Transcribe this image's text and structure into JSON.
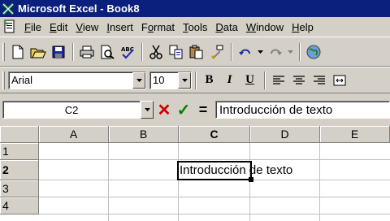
{
  "window": {
    "title": "Microsoft Excel - Book8"
  },
  "menu": {
    "items": [
      {
        "accel": "F",
        "rest": "ile"
      },
      {
        "accel": "E",
        "rest": "dit"
      },
      {
        "accel": "V",
        "rest": "iew"
      },
      {
        "accel": "I",
        "rest": "nsert"
      },
      {
        "pre": "F",
        "accel": "o",
        "rest": "rmat"
      },
      {
        "accel": "T",
        "rest": "ools"
      },
      {
        "accel": "D",
        "rest": "ata"
      },
      {
        "accel": "W",
        "rest": "indow"
      },
      {
        "accel": "H",
        "rest": "elp"
      }
    ]
  },
  "standard_toolbar": {
    "icons": [
      "new-icon",
      "open-icon",
      "save-icon",
      "print-icon",
      "print-preview-icon",
      "spelling-icon",
      "cut-icon",
      "copy-icon",
      "paste-icon",
      "format-painter-icon",
      "undo-icon",
      "redo-icon",
      "web-icon"
    ]
  },
  "formatting_toolbar": {
    "font": "Arial",
    "size": "10",
    "bold_label": "B",
    "italic_label": "I",
    "underline_label": "U"
  },
  "formula_bar": {
    "name_box": "C2",
    "cancel_symbol": "✕",
    "enter_symbol": "✓",
    "equals_symbol": "=",
    "content": "Introducción de texto"
  },
  "sheet": {
    "columns": [
      "A",
      "B",
      "C",
      "D",
      "E"
    ],
    "rows": [
      "1",
      "2",
      "3",
      "4"
    ],
    "active_cell": "C2",
    "active_cell_text": "Introducción de texto"
  },
  "colors": {
    "titlebar": "#0b1f7c",
    "chrome": "#d4d0c8",
    "cancel": "#cc0000",
    "enter": "#008000"
  }
}
